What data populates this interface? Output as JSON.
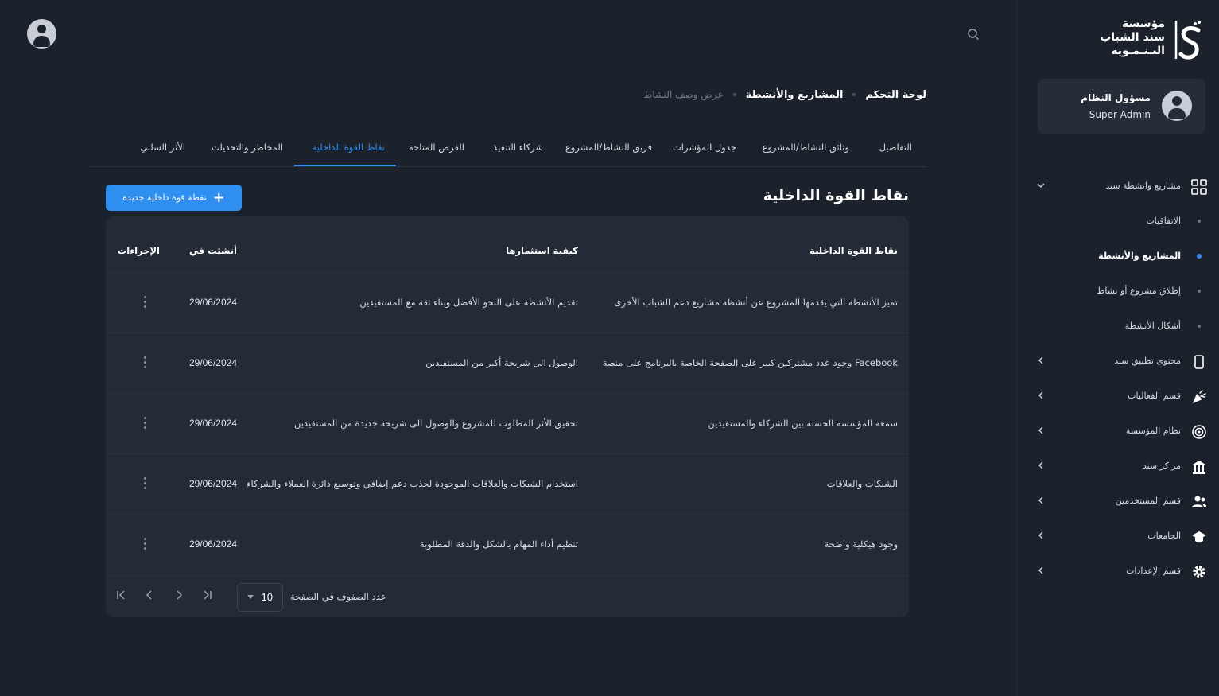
{
  "app": {
    "logo_lines": [
      "مؤسسة",
      "سند الشباب",
      "التـنـمـوية"
    ],
    "accent": "#2f8ff0"
  },
  "user": {
    "name": "مسؤول النظام",
    "role": "Super Admin"
  },
  "sidebar": {
    "items": [
      {
        "label": "مشاريع وانشطة سند",
        "icon": "grid-icon",
        "expanded": true
      },
      {
        "label": "الاتفاقيات",
        "sub": true
      },
      {
        "label": "المشاريع والأنشطة",
        "sub": true,
        "active": true
      },
      {
        "label": "إطلاق مشروع أو نشاط",
        "sub": true
      },
      {
        "label": "أشكال الأنشطة",
        "sub": true
      },
      {
        "label": "محتوى تطبيق سند",
        "icon": "mobile-icon"
      },
      {
        "label": "قسم الفعاليات",
        "icon": "party-icon"
      },
      {
        "label": "نظام المؤسسة",
        "icon": "target-icon"
      },
      {
        "label": "مراكز سند",
        "icon": "building-icon"
      },
      {
        "label": "قسم المستخدمين",
        "icon": "users-icon"
      },
      {
        "label": "الجامعات",
        "icon": "graduation-cap-icon"
      },
      {
        "label": "قسم الإعدادات",
        "icon": "gear-icon"
      }
    ]
  },
  "breadcrumb": [
    "لوحة التحكم",
    "المشاريع والأنشطة",
    "عرض وصف النشاط"
  ],
  "tabs": [
    {
      "label": "التفاصيل"
    },
    {
      "label": "وثائق النشاط/المشروع"
    },
    {
      "label": "جدول المؤشرات"
    },
    {
      "label": "فريق النشاط/المشروع"
    },
    {
      "label": "شركاء التنفيذ"
    },
    {
      "label": "الفرص المتاحة"
    },
    {
      "label": "نقاط القوة الداخلية",
      "active": true
    },
    {
      "label": "المخاطر والتحديات"
    },
    {
      "label": "الأثر السلبي"
    }
  ],
  "section": {
    "title": "نقاط القوة الداخلية",
    "add_button": "نقطة قوة داخلية جديدة"
  },
  "table": {
    "headers": {
      "strength": "نقاط القوة الداخلية",
      "usage": "كيفية استثمارها",
      "created": "أنشئت في",
      "actions": "الإجراءات"
    },
    "rows": [
      {
        "strength": "تميز الأنشطة التي يقدمها المشروع عن أنشطة مشاريع دعم الشباب الأخرى",
        "usage": "تقديم الأنشطة على النحو الأفضل وبناء ثقة مع المستفيدين",
        "created": "29/06/2024"
      },
      {
        "strength": "وجود عدد مشتركين كبير على الصفحة الخاصة بالبرنامج على منصة Facebook",
        "usage": "الوصول الى شريحة أكبر من المستفيدين",
        "created": "29/06/2024"
      },
      {
        "strength": "سمعة المؤسسة الحسنة بين الشركاء والمستفيدين",
        "usage": "تحقيق الأثر المطلوب للمشروع والوصول الى شريحة جديدة من المستفيدين",
        "created": "29/06/2024"
      },
      {
        "strength": "الشبكات والعلاقات",
        "usage": "استخدام الشبكات والعلاقات الموجودة لجذب دعم إضافي وتوسيع دائرة العملاء والشركاء",
        "created": "29/06/2024"
      },
      {
        "strength": "وجود هيكلية واضحة",
        "usage": "تنظيم أداء المهام بالشكل والدقة المطلوبة",
        "created": "29/06/2024"
      }
    ]
  },
  "pagination": {
    "rows_per_page_label": "عدد الصفوف في الصفحة",
    "rows_per_page": "10"
  }
}
